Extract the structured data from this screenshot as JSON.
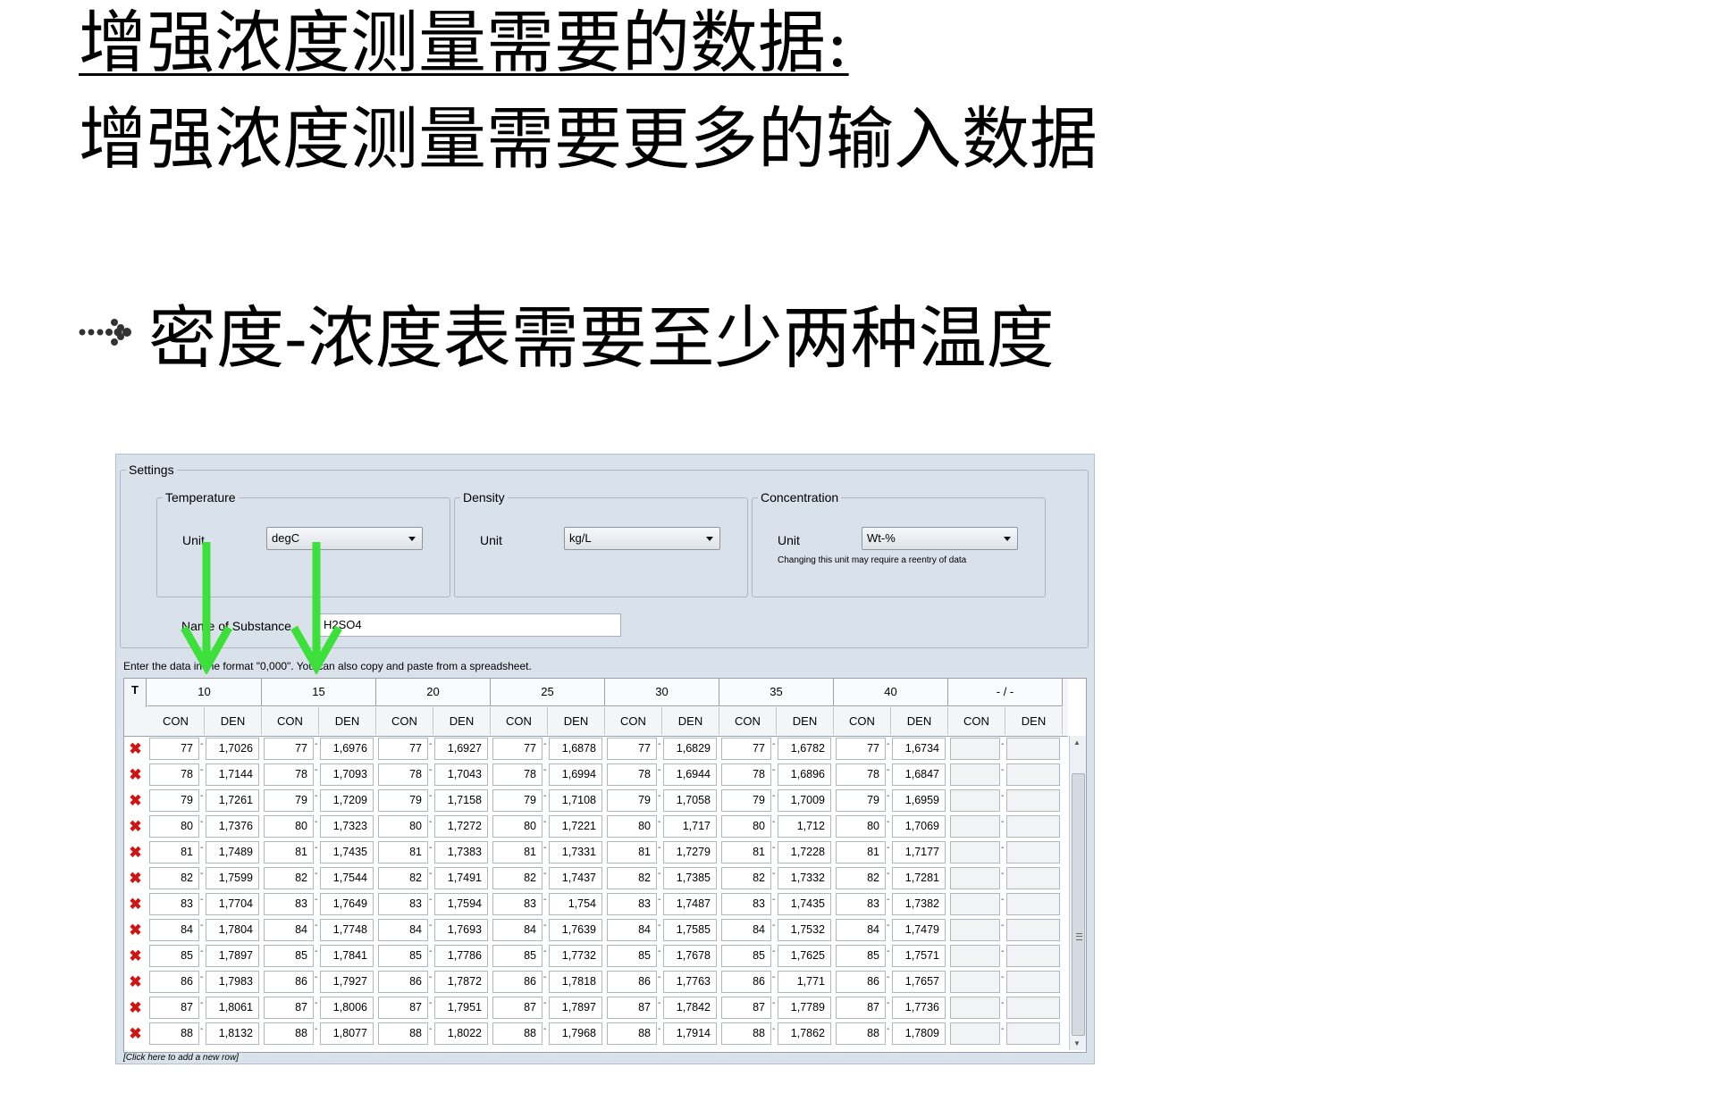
{
  "slide": {
    "title": "增强浓度测量需要的数据:",
    "subtitle": "增强浓度测量需要更多的输入数据",
    "bullet": "密度-浓度表需要至少两种温度"
  },
  "settings": {
    "label": "Settings",
    "temperature": {
      "label": "Temperature",
      "unit_label": "Unit",
      "unit_value": "degC"
    },
    "density": {
      "label": "Density",
      "unit_label": "Unit",
      "unit_value": "kg/L"
    },
    "concentration": {
      "label": "Concentration",
      "unit_label": "Unit",
      "unit_value": "Wt-%",
      "note": "Changing this unit may require a reentry of data"
    },
    "substance": {
      "label": "Name of Substance",
      "value": "H2SO4"
    }
  },
  "grid": {
    "instruction": "Enter the data in the format \"0,000\". You can also copy and paste from a spreadsheet.",
    "t_header": "T",
    "con_label": "CON",
    "den_label": "DEN",
    "temperatures": [
      "10",
      "15",
      "20",
      "25",
      "30",
      "35",
      "40",
      "- / -"
    ],
    "rows": [
      {
        "con": "77",
        "den": [
          "1,7026",
          "1,6976",
          "1,6927",
          "1,6878",
          "1,6829",
          "1,6782",
          "1,6734"
        ]
      },
      {
        "con": "78",
        "den": [
          "1,7144",
          "1,7093",
          "1,7043",
          "1,6994",
          "1,6944",
          "1,6896",
          "1,6847"
        ]
      },
      {
        "con": "79",
        "den": [
          "1,7261",
          "1,7209",
          "1,7158",
          "1,7108",
          "1,7058",
          "1,7009",
          "1,6959"
        ]
      },
      {
        "con": "80",
        "den": [
          "1,7376",
          "1,7323",
          "1,7272",
          "1,7221",
          "1,717",
          "1,712",
          "1,7069"
        ]
      },
      {
        "con": "81",
        "den": [
          "1,7489",
          "1,7435",
          "1,7383",
          "1,7331",
          "1,7279",
          "1,7228",
          "1,7177"
        ]
      },
      {
        "con": "82",
        "den": [
          "1,7599",
          "1,7544",
          "1,7491",
          "1,7437",
          "1,7385",
          "1,7332",
          "1,7281"
        ]
      },
      {
        "con": "83",
        "den": [
          "1,7704",
          "1,7649",
          "1,7594",
          "1,754",
          "1,7487",
          "1,7435",
          "1,7382"
        ]
      },
      {
        "con": "84",
        "den": [
          "1,7804",
          "1,7748",
          "1,7693",
          "1,7639",
          "1,7585",
          "1,7532",
          "1,7479"
        ]
      },
      {
        "con": "85",
        "den": [
          "1,7897",
          "1,7841",
          "1,7786",
          "1,7732",
          "1,7678",
          "1,7625",
          "1,7571"
        ]
      },
      {
        "con": "86",
        "den": [
          "1,7983",
          "1,7927",
          "1,7872",
          "1,7818",
          "1,7763",
          "1,771",
          "1,7657"
        ]
      },
      {
        "con": "87",
        "den": [
          "1,8061",
          "1,8006",
          "1,7951",
          "1,7897",
          "1,7842",
          "1,7789",
          "1,7736"
        ]
      },
      {
        "con": "88",
        "den": [
          "1,8132",
          "1,8077",
          "1,8022",
          "1,7968",
          "1,7914",
          "1,7862",
          "1,7809"
        ]
      }
    ],
    "add_row": "[Click here to add a new row]"
  },
  "icons": {
    "delete": "delete-row-icon",
    "bullet": "dotted-arrow-bullet-icon",
    "highlight_arrow": "down-arrow-icon"
  },
  "colors": {
    "arrow": "#3de03a",
    "delete": "#d01414",
    "app_bg": "#d9e1ea"
  }
}
